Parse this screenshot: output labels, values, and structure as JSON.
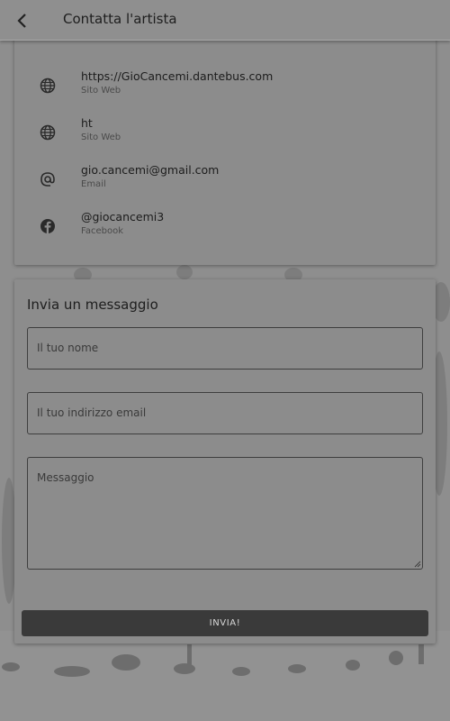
{
  "header": {
    "title": "Contatta l'artista",
    "back_icon": "chevron-left-icon"
  },
  "contacts": [
    {
      "icon": "globe-icon",
      "value": "https://GioCancemi.dantebus.com",
      "type": "Sito Web"
    },
    {
      "icon": "globe-icon",
      "value": "ht",
      "type": "Sito Web"
    },
    {
      "icon": "at-sign-icon",
      "value": "gio.cancemi@gmail.com",
      "type": "Email"
    },
    {
      "icon": "facebook-icon",
      "value": "@giocancemi3",
      "type": "Facebook"
    }
  ],
  "form": {
    "title": "Invia un messaggio",
    "name_placeholder": "Il tuo nome",
    "email_placeholder": "Il tuo indirizzo email",
    "message_placeholder": "Messaggio",
    "send_label": "INVIA!"
  },
  "colors": {
    "overlay_gray": "#8d8d8d",
    "button_dark": "#3a3a3a"
  }
}
